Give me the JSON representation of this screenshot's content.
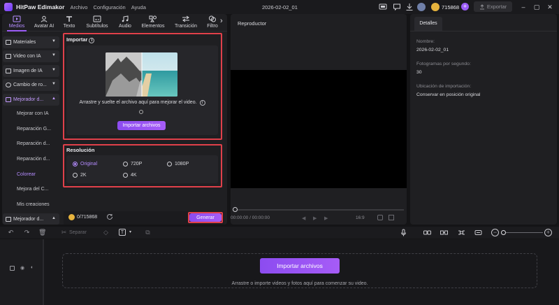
{
  "app": {
    "name": "HitPaw Edimakor",
    "menu": [
      "Archivo",
      "Configuración",
      "Ayuda"
    ],
    "project_title": "2026-02-02_01",
    "credits": "715868",
    "export_label": "Exportar",
    "accent": "#9b5cf6"
  },
  "tabs": [
    {
      "label": "Medios",
      "icon": "media-icon",
      "active": true
    },
    {
      "label": "Avatar AI",
      "icon": "avatar-icon",
      "active": false
    },
    {
      "label": "Texto",
      "icon": "text-icon",
      "active": false
    },
    {
      "label": "Subtítulos",
      "icon": "subtitles-icon",
      "active": false
    },
    {
      "label": "Audio",
      "icon": "audio-icon",
      "active": false
    },
    {
      "label": "Elementos",
      "icon": "elements-icon",
      "active": false
    },
    {
      "label": "Transición",
      "icon": "transition-icon",
      "active": false
    },
    {
      "label": "Filtro",
      "icon": "filter-icon",
      "active": false
    }
  ],
  "sidebar": {
    "items": [
      {
        "label": "Materiales"
      },
      {
        "label": "Video con IA"
      },
      {
        "label": "Imagen de IA"
      },
      {
        "label": "Cambio de ro..."
      },
      {
        "label": "Mejorador d..."
      }
    ],
    "subitems": [
      {
        "label": "Mejorar con IA",
        "active": false
      },
      {
        "label": "Reparación G...",
        "active": false
      },
      {
        "label": "Reparación d...",
        "active": false
      },
      {
        "label": "Reparación d...",
        "active": false
      },
      {
        "label": "Colorear",
        "active": true
      },
      {
        "label": "Mejora del C...",
        "active": false
      },
      {
        "label": "Mis creaciones",
        "active": false
      }
    ],
    "bottom_item": "Mejorador d..."
  },
  "import": {
    "title": "Importar",
    "drop_text": "Arrastre y suelte el archivo aquí para mejorar el video.",
    "button": "Importar archivos"
  },
  "resolution": {
    "title": "Resolución",
    "options": [
      {
        "label": "Original",
        "checked": true
      },
      {
        "label": "720P",
        "checked": false
      },
      {
        "label": "1080P",
        "checked": false
      },
      {
        "label": "2K",
        "checked": false
      },
      {
        "label": "4K",
        "checked": false
      }
    ]
  },
  "generate": {
    "credits": "0/715868",
    "button": "Generar"
  },
  "player": {
    "title": "Reproductor",
    "time": "00:00:00 / 00:00:00",
    "ratio": "16:9"
  },
  "details": {
    "tab": "Detalles",
    "fields": [
      {
        "label": "Nombre:",
        "value": "2026-02-02_01"
      },
      {
        "label": "Fotogramas por segundo:",
        "value": "30"
      },
      {
        "label": "Ubicación de importación:",
        "value": "Conservar en posición original"
      }
    ]
  },
  "timeline": {
    "split_label": "Separar",
    "import_button": "Importar archivos",
    "hint": "Arrastre o importe videos y fotos aquí para comenzar su video."
  }
}
